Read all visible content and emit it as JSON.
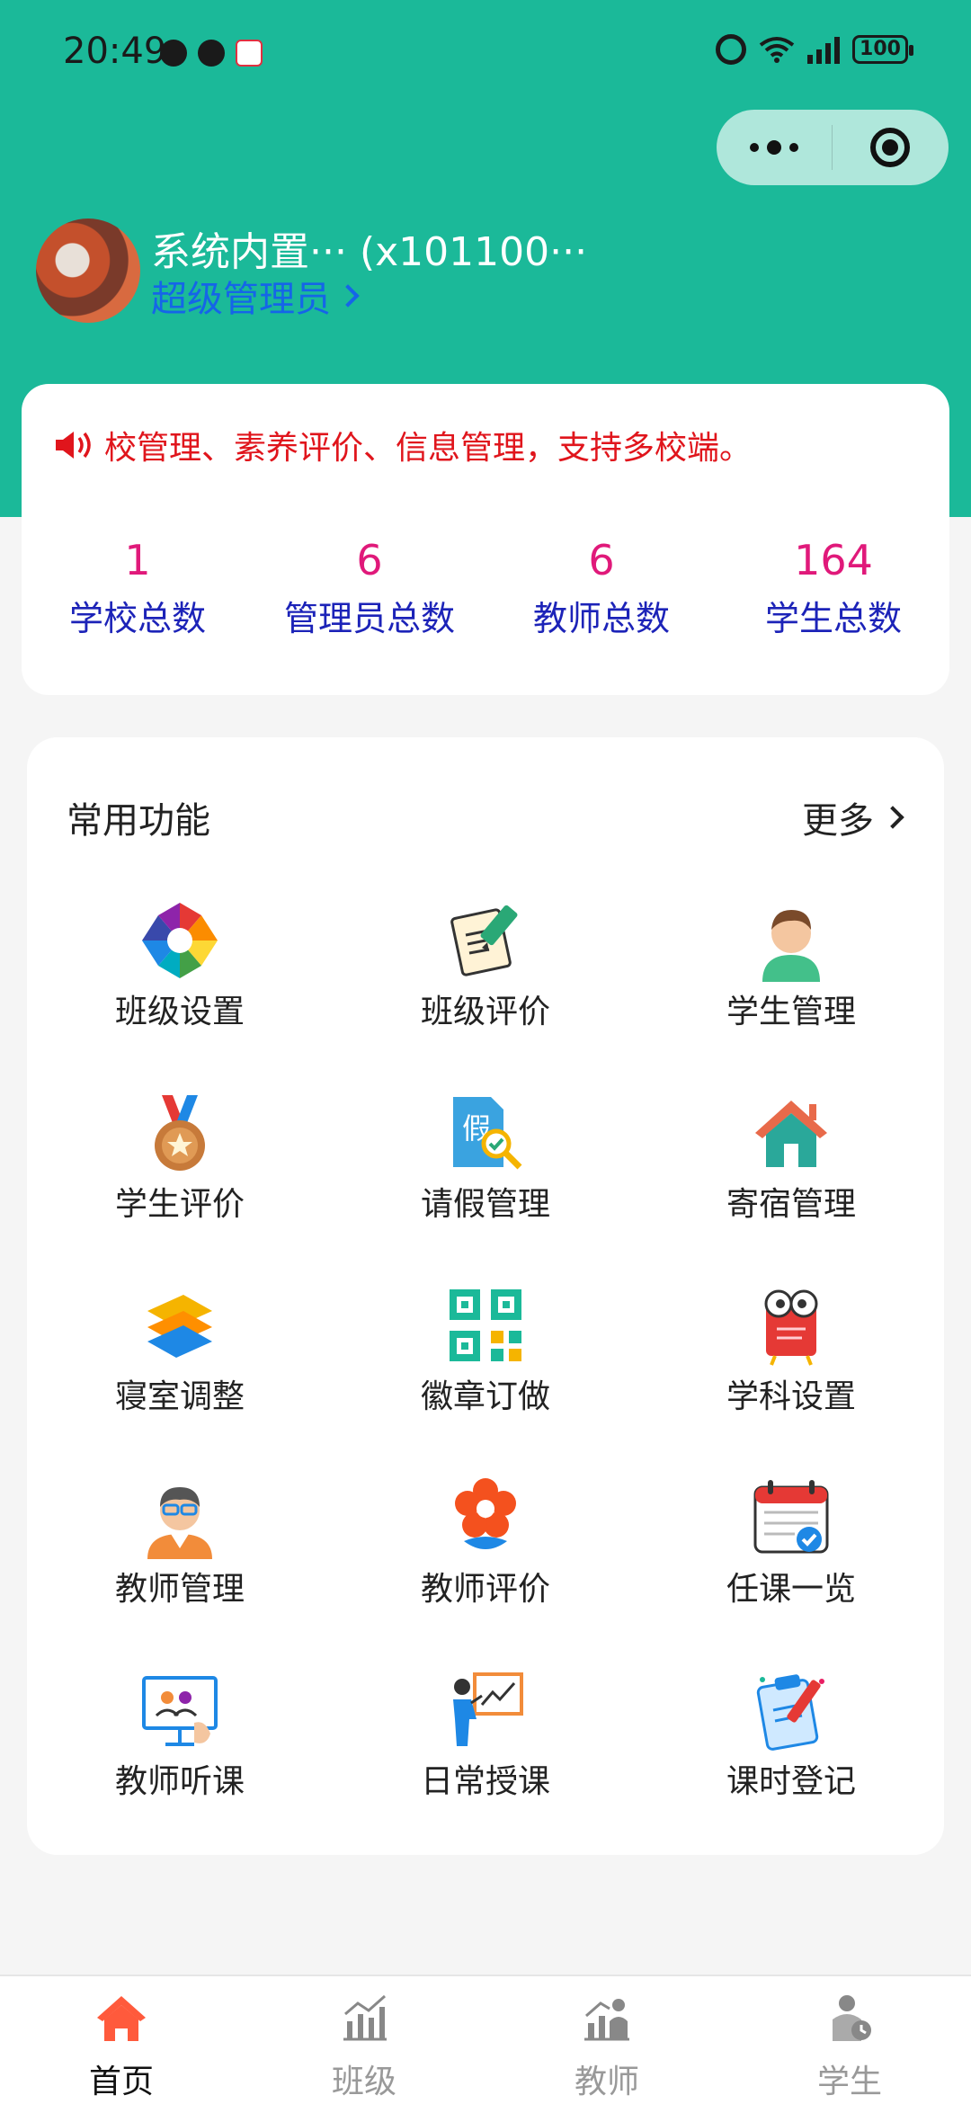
{
  "status_bar": {
    "time": "20:49",
    "battery": "100"
  },
  "user": {
    "name": "系统内置··· (x101100···",
    "role": "超级管理员"
  },
  "notice": {
    "text": "校管理、素养评价、信息管理，支持多校端。"
  },
  "stats": [
    {
      "value": "1",
      "label": "学校总数"
    },
    {
      "value": "6",
      "label": "管理员总数"
    },
    {
      "value": "6",
      "label": "教师总数"
    },
    {
      "value": "164",
      "label": "学生总数"
    }
  ],
  "functions": {
    "title": "常用功能",
    "more_label": "更多",
    "items": [
      {
        "label": "班级设置",
        "icon": "aperture-icon"
      },
      {
        "label": "班级评价",
        "icon": "document-pen-icon"
      },
      {
        "label": "学生管理",
        "icon": "student-avatar-icon"
      },
      {
        "label": "学生评价",
        "icon": "medal-icon"
      },
      {
        "label": "请假管理",
        "icon": "leave-doc-icon"
      },
      {
        "label": "寄宿管理",
        "icon": "house-icon"
      },
      {
        "label": "寝室调整",
        "icon": "layers-icon"
      },
      {
        "label": "徽章订做",
        "icon": "qr-code-icon"
      },
      {
        "label": "学科设置",
        "icon": "book-owl-icon"
      },
      {
        "label": "教师管理",
        "icon": "teacher-avatar-icon"
      },
      {
        "label": "教师评价",
        "icon": "flower-icon"
      },
      {
        "label": "任课一览",
        "icon": "calendar-check-icon"
      },
      {
        "label": "教师听课",
        "icon": "presentation-screen-icon"
      },
      {
        "label": "日常授课",
        "icon": "lecture-board-icon"
      },
      {
        "label": "课时登记",
        "icon": "clipboard-icon"
      }
    ]
  },
  "tabs": [
    {
      "label": "首页",
      "icon": "home-icon",
      "active": true
    },
    {
      "label": "班级",
      "icon": "chart-icon",
      "active": false
    },
    {
      "label": "教师",
      "icon": "teacher-chart-icon",
      "active": false
    },
    {
      "label": "学生",
      "icon": "student-icon",
      "active": false
    }
  ],
  "colors": {
    "header": "#1bb999",
    "notice": "#e0151c",
    "stat_value": "#e0197a",
    "stat_label": "#1c23b8",
    "role_link": "#1565e8",
    "tab_active": "#ff5a3c"
  }
}
